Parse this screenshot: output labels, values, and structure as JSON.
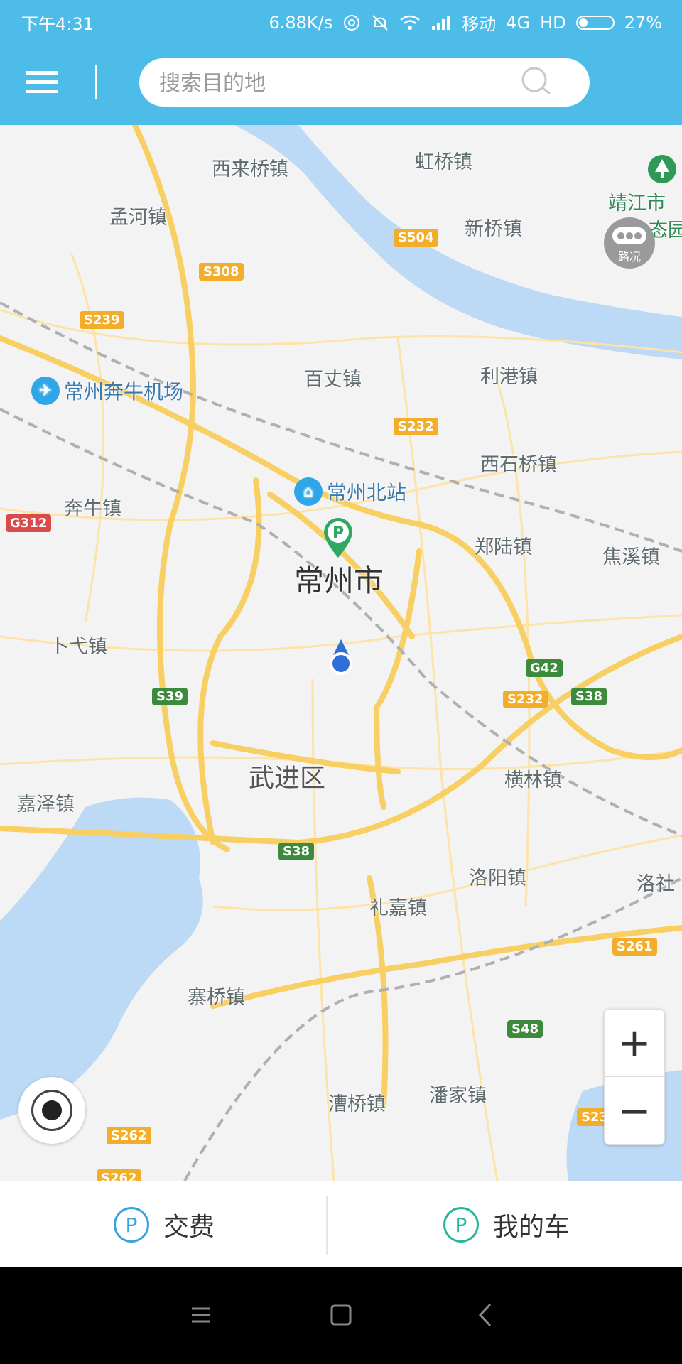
{
  "status_bar": {
    "time": "下午4:31",
    "speed": "6.88K/s",
    "carrier": "移动",
    "network": "4G",
    "hd": "HD",
    "battery": "27%",
    "battery_level": 0.27
  },
  "header": {
    "search_placeholder": "搜索目的地"
  },
  "map": {
    "places": {
      "xilaiqiao": "西来桥镇",
      "hongqiao": "虹桥镇",
      "menghe": "孟河镇",
      "xinqiao": "新桥镇",
      "jingjiang": "靖江市",
      "jingjiang2": "生态园",
      "baizhang": "百丈镇",
      "ligang": "利港镇",
      "xishiqiao": "西石桥镇",
      "benniu": "奔牛镇",
      "zhengliu": "郑陆镇",
      "jiaoxi": "焦溪镇",
      "changzhou": "常州市",
      "buge": "卜弋镇",
      "wujin": "武进区",
      "henglin": "横林镇",
      "jiaze": "嘉泽镇",
      "luoyang": "洛阳镇",
      "luoshe": "洛社",
      "lijia": "礼嘉镇",
      "saiqiao": "寨桥镇",
      "caoqiao": "漕桥镇",
      "panjia": "潘家镇"
    },
    "pois": {
      "airport": "常州奔牛机场",
      "north_station": "常州北站"
    },
    "roads": {
      "s504": "S504",
      "s308": "S308",
      "s239": "S239",
      "s232a": "S232",
      "g312": "G312",
      "g42": "G42",
      "s232b": "S232",
      "s38a": "S38",
      "s39": "S39",
      "s38b": "S38",
      "s261": "S261",
      "s48": "S48",
      "s262a": "S262",
      "s262b": "S262",
      "s23": "S23"
    },
    "traffic_label": "路况",
    "zoom_in": "+",
    "zoom_out": "−"
  },
  "bottom_bar": {
    "pay_label": "交费",
    "car_label": "我的车",
    "pay_icon_text": "P",
    "car_icon_text": "P"
  },
  "colors": {
    "accent": "#4ebce8",
    "water": "#bcd9f5",
    "road": "#f8cf62"
  }
}
